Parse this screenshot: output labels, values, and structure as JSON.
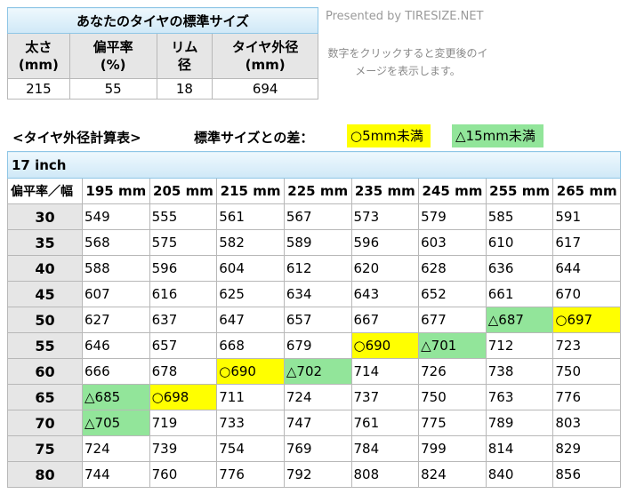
{
  "standard": {
    "title": "あなたのタイヤの標準サイズ",
    "headers": [
      [
        "太さ",
        "(mm)"
      ],
      [
        "偏平率",
        "(%)"
      ],
      [
        "リム",
        "径"
      ],
      [
        "タイヤ外径",
        "(mm)"
      ]
    ],
    "values": [
      "215",
      "55",
      "18",
      "694"
    ]
  },
  "presented_by": "Presented by TIRESIZE.NET",
  "hint": "数字をクリックすると変更後のイメージを表示します。",
  "calc_title": "<タイヤ外径計算表>",
  "diff_label": "標準サイズとの差：",
  "legend": {
    "yellow": "○5mm未満",
    "green": "△15mm未満"
  },
  "colors": {
    "yellow": "#ffff00",
    "green": "#92e59a",
    "header_blue": "#cfe8f7",
    "row_header_gray": "#e6e6e6"
  },
  "table": {
    "inch": "17 inch",
    "corner": "偏平率／幅",
    "widths": [
      "195 mm",
      "205 mm",
      "215 mm",
      "225 mm",
      "235 mm",
      "245 mm",
      "255 mm",
      "265 mm"
    ],
    "rows": [
      {
        "ratio": "30",
        "cells": [
          {
            "v": "549"
          },
          {
            "v": "555"
          },
          {
            "v": "561"
          },
          {
            "v": "567"
          },
          {
            "v": "573"
          },
          {
            "v": "579"
          },
          {
            "v": "585"
          },
          {
            "v": "591"
          }
        ]
      },
      {
        "ratio": "35",
        "cells": [
          {
            "v": "568"
          },
          {
            "v": "575"
          },
          {
            "v": "582"
          },
          {
            "v": "589"
          },
          {
            "v": "596"
          },
          {
            "v": "603"
          },
          {
            "v": "610"
          },
          {
            "v": "617"
          }
        ]
      },
      {
        "ratio": "40",
        "cells": [
          {
            "v": "588"
          },
          {
            "v": "596"
          },
          {
            "v": "604"
          },
          {
            "v": "612"
          },
          {
            "v": "620"
          },
          {
            "v": "628"
          },
          {
            "v": "636"
          },
          {
            "v": "644"
          }
        ]
      },
      {
        "ratio": "45",
        "cells": [
          {
            "v": "607"
          },
          {
            "v": "616"
          },
          {
            "v": "625"
          },
          {
            "v": "634"
          },
          {
            "v": "643"
          },
          {
            "v": "652"
          },
          {
            "v": "661"
          },
          {
            "v": "670"
          }
        ]
      },
      {
        "ratio": "50",
        "cells": [
          {
            "v": "627"
          },
          {
            "v": "637"
          },
          {
            "v": "647"
          },
          {
            "v": "657"
          },
          {
            "v": "667"
          },
          {
            "v": "677"
          },
          {
            "v": "△687",
            "h": "green"
          },
          {
            "v": "○697",
            "h": "yellow"
          }
        ]
      },
      {
        "ratio": "55",
        "cells": [
          {
            "v": "646"
          },
          {
            "v": "657"
          },
          {
            "v": "668"
          },
          {
            "v": "679"
          },
          {
            "v": "○690",
            "h": "yellow"
          },
          {
            "v": "△701",
            "h": "green"
          },
          {
            "v": "712"
          },
          {
            "v": "723"
          }
        ]
      },
      {
        "ratio": "60",
        "cells": [
          {
            "v": "666"
          },
          {
            "v": "678"
          },
          {
            "v": "○690",
            "h": "yellow"
          },
          {
            "v": "△702",
            "h": "green"
          },
          {
            "v": "714"
          },
          {
            "v": "726"
          },
          {
            "v": "738"
          },
          {
            "v": "750"
          }
        ]
      },
      {
        "ratio": "65",
        "cells": [
          {
            "v": "△685",
            "h": "green"
          },
          {
            "v": "○698",
            "h": "yellow"
          },
          {
            "v": "711"
          },
          {
            "v": "724"
          },
          {
            "v": "737"
          },
          {
            "v": "750"
          },
          {
            "v": "763"
          },
          {
            "v": "776"
          }
        ]
      },
      {
        "ratio": "70",
        "cells": [
          {
            "v": "△705",
            "h": "green"
          },
          {
            "v": "719"
          },
          {
            "v": "733"
          },
          {
            "v": "747"
          },
          {
            "v": "761"
          },
          {
            "v": "775"
          },
          {
            "v": "789"
          },
          {
            "v": "803"
          }
        ]
      },
      {
        "ratio": "75",
        "cells": [
          {
            "v": "724"
          },
          {
            "v": "739"
          },
          {
            "v": "754"
          },
          {
            "v": "769"
          },
          {
            "v": "784"
          },
          {
            "v": "799"
          },
          {
            "v": "814"
          },
          {
            "v": "829"
          }
        ]
      },
      {
        "ratio": "80",
        "cells": [
          {
            "v": "744"
          },
          {
            "v": "760"
          },
          {
            "v": "776"
          },
          {
            "v": "792"
          },
          {
            "v": "808"
          },
          {
            "v": "824"
          },
          {
            "v": "840"
          },
          {
            "v": "856"
          }
        ]
      }
    ]
  }
}
